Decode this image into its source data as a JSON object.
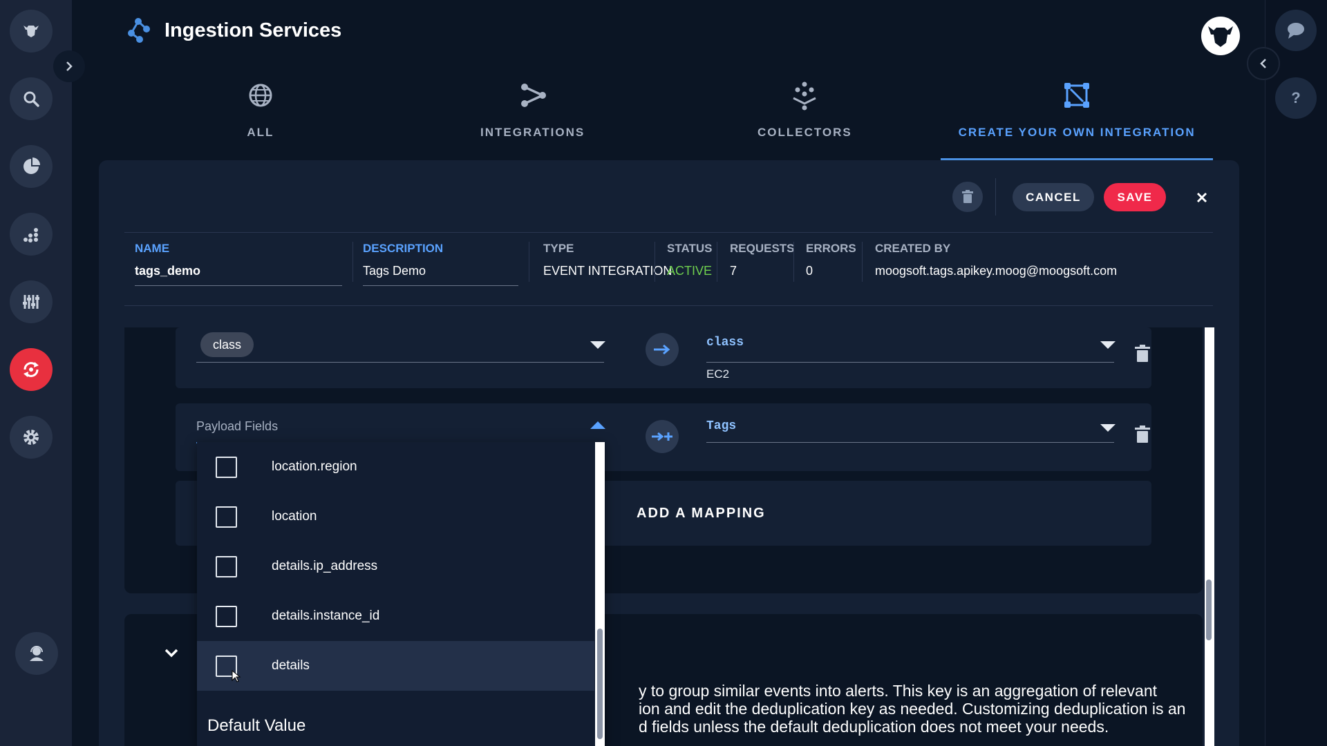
{
  "app": {
    "title": "Ingestion Services",
    "logo_icon": "ingestion-logo-icon",
    "user_avatar": "bull-avatar-icon"
  },
  "left_rail": {
    "items": [
      {
        "icon": "bull-logo-icon"
      },
      {
        "icon": "search-icon"
      },
      {
        "icon": "pie-chart-icon"
      },
      {
        "icon": "scatter-chart-icon"
      },
      {
        "icon": "sliders-icon"
      },
      {
        "icon": "sync-icon",
        "active": true
      },
      {
        "icon": "gear-icon"
      }
    ],
    "bottom_icon": "support-agent-icon",
    "expand_icon": "chevron-right-icon"
  },
  "right_rail": {
    "items": [
      {
        "icon": "chat-icon"
      },
      {
        "icon": "help-icon"
      }
    ],
    "collapse_icon": "chevron-left-icon"
  },
  "tabs": [
    {
      "label": "ALL",
      "icon": "globe-icon",
      "active": false
    },
    {
      "label": "INTEGRATIONS",
      "icon": "share-icon",
      "active": false
    },
    {
      "label": "COLLECTORS",
      "icon": "collectors-icon",
      "active": false
    },
    {
      "label": "CREATE YOUR OWN INTEGRATION",
      "icon": "custom-integration-icon",
      "active": true
    }
  ],
  "toolbar": {
    "cancel_label": "CANCEL",
    "save_label": "SAVE"
  },
  "info": {
    "name_label": "NAME",
    "name_value": "tags_demo",
    "description_label": "DESCRIPTION",
    "description_value": "Tags Demo",
    "type_label": "TYPE",
    "type_value": "EVENT INTEGRATION",
    "status_label": "STATUS",
    "status_value": "ACTIVE",
    "requests_label": "REQUESTS",
    "requests_value": "7",
    "errors_label": "ERRORS",
    "errors_value": "0",
    "created_by_label": "CREATED BY",
    "created_by_value": "moogsoft.tags.apikey.moog@moogsoft.com"
  },
  "mappings": [
    {
      "source_chip": "class",
      "target": "class",
      "target_value": "EC2"
    },
    {
      "source_placeholder": "Payload Fields",
      "target": "Tags"
    }
  ],
  "add_mapping_label": "ADD A MAPPING",
  "dropdown": {
    "items": [
      {
        "label": "location.region",
        "checked": false
      },
      {
        "label": "location",
        "checked": false
      },
      {
        "label": "details.ip_address",
        "checked": false
      },
      {
        "label": "details.instance_id",
        "checked": false
      },
      {
        "label": "details",
        "checked": false
      }
    ],
    "default_value_label": "Default Value"
  },
  "dedup": {
    "text_lines": [
      "y to group similar events into alerts. This key is an aggregation of relevant",
      "ion and edit the deduplication key as needed. Customizing deduplication is an",
      "d fields unless the default deduplication does not meet your needs."
    ]
  },
  "colors": {
    "accent": "#5aa2ff",
    "save": "#f0294a",
    "active_rail": "#e8303f",
    "status_active": "#6fd04e"
  }
}
